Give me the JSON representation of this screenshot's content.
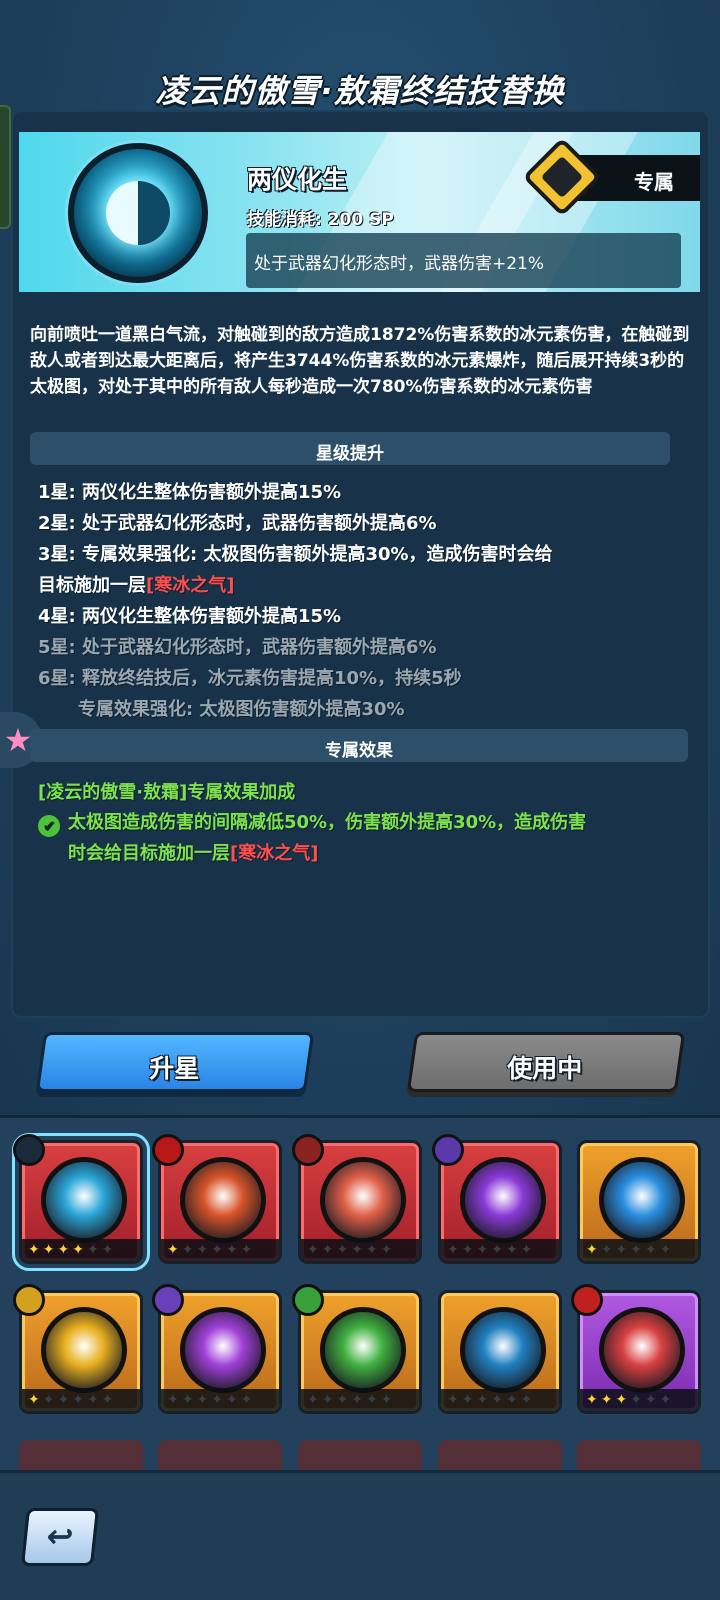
{
  "header": {
    "title": "凌云的傲雪·敖霜终结技替换"
  },
  "skill": {
    "name": "两仪化生",
    "cost": "技能消耗: 200 SP",
    "effect": "处于武器幻化形态时，武器伤害+21%",
    "exclusive_label": "专属",
    "description": "向前喷吐一道黑白气流，对触碰到的敌方造成1872%伤害系数的冰元素伤害，在触碰到敌人或者到达最大距离后，将产生3744%伤害系数的冰元素爆炸，随后展开持续3秒的太极图，对处于其中的所有敌人每秒造成一次780%伤害系数的冰元素伤害"
  },
  "star_upgrade": {
    "heading": "星级提升",
    "lines": [
      {
        "text": "1星: 两仪化生整体伤害额外提高15%"
      },
      {
        "text": "2星: 处于武器幻化形态时，武器伤害额外提高6%"
      },
      {
        "text": "3星: 专属效果强化: 太极图伤害额外提高30%，造成伤害时会给"
      },
      {
        "text_prefix": "目标施加一层",
        "text_red": "[寒冰之气]"
      },
      {
        "text": "4星: 两仪化生整体伤害额外提高15%"
      },
      {
        "text": "5星: 处于武器幻化形态时，武器伤害额外提高6%"
      },
      {
        "text": "6星: 释放终结技后，冰元素伤害提高10%，持续5秒"
      },
      {
        "text": "专属效果强化: 太极图伤害额外提高30%"
      }
    ]
  },
  "exclusive": {
    "heading": "专属效果",
    "title": "[凌云的傲雪·敖霜]专属效果加成",
    "line1": "太极图造成伤害的间隔减低50%，伤害额外提高30%，造成伤害",
    "line2_prefix": "时会给目标施加一层",
    "line2_red": "[寒冰之气]"
  },
  "buttons": {
    "upgrade": "升星",
    "in_use": "使用中"
  },
  "cards": [
    {
      "frame": "red",
      "orb": "#2aa6d8",
      "badge": "#1b2a3a",
      "stars_on": 4,
      "selected": true
    },
    {
      "frame": "red",
      "orb": "#d8542a",
      "badge": "#b81818",
      "stars_on": 1
    },
    {
      "frame": "red",
      "orb": "#e06048",
      "badge": "#8a2222",
      "stars_on": 0
    },
    {
      "frame": "red",
      "orb": "#8a3ad8",
      "badge": "#5a3aa8",
      "stars_on": 0
    },
    {
      "frame": "gold",
      "orb": "#2a8ee0",
      "badge": null,
      "stars_on": 1
    },
    {
      "frame": "gold",
      "orb": "#e8b020",
      "badge": "#d4a020",
      "stars_on": 1
    },
    {
      "frame": "gold",
      "orb": "#a040d8",
      "badge": "#6a40b8",
      "stars_on": 0
    },
    {
      "frame": "gold",
      "orb": "#40b040",
      "badge": "#3aa03a",
      "stars_on": 0
    },
    {
      "frame": "gold",
      "orb": "#2080c0",
      "badge": null,
      "stars_on": 0
    },
    {
      "frame": "purple",
      "orb": "#d84040",
      "badge": "#c02020",
      "stars_on": 3
    }
  ],
  "icons": {
    "back": "back-arrow-icon",
    "check": "check-circle-icon",
    "side_star": "star-icon"
  },
  "colors": {
    "accent_blue": "#2a84e6",
    "red_text": "#ff4d4d",
    "green_text": "#7de34c"
  }
}
